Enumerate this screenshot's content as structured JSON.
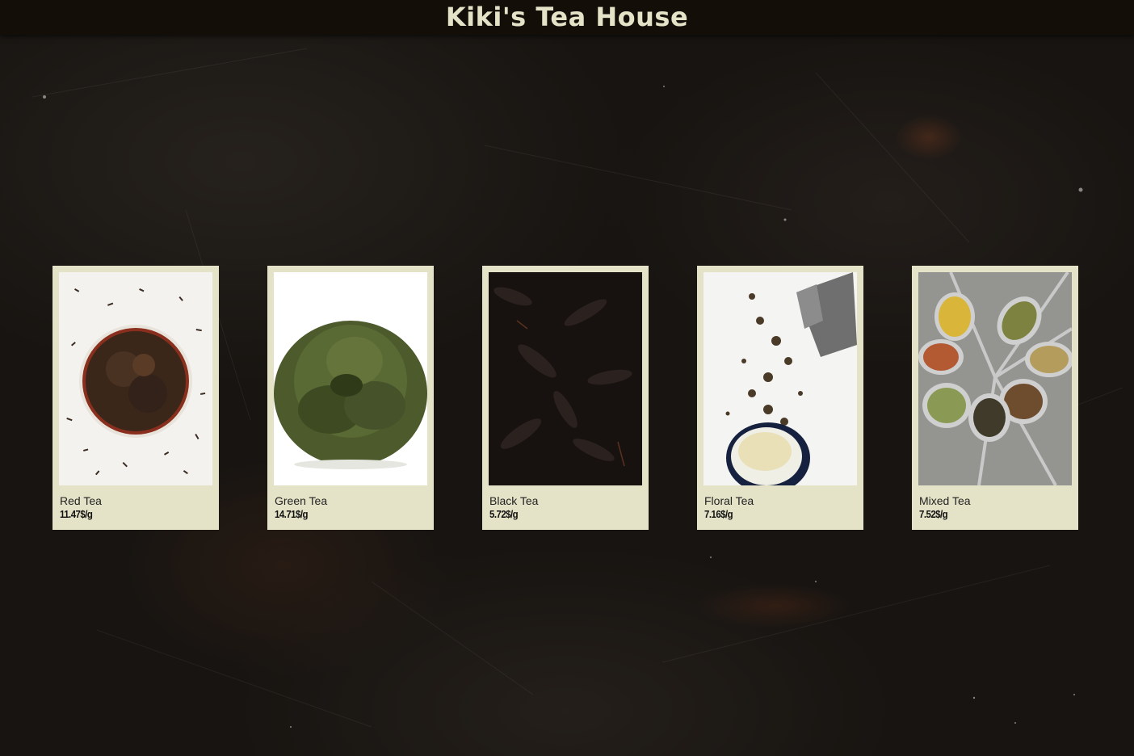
{
  "site": {
    "title": "Kiki's Tea House"
  },
  "colors": {
    "header_bg": "#140e09",
    "title_color": "#e4e3c8",
    "card_bg": "#e4e3c7",
    "page_bg": "#171411"
  },
  "products": [
    {
      "name": "Red Tea",
      "price": "11.47$/g",
      "image": "red-tea-bowl-photo"
    },
    {
      "name": "Green Tea",
      "price": "14.71$/g",
      "image": "green-tea-pile-photo"
    },
    {
      "name": "Black Tea",
      "price": "5.72$/g",
      "image": "black-tea-leaves-photo"
    },
    {
      "name": "Floral Tea",
      "price": "7.16$/g",
      "image": "floral-tea-cup-photo"
    },
    {
      "name": "Mixed Tea",
      "price": "7.52$/g",
      "image": "mixed-tea-spoons-photo"
    }
  ]
}
